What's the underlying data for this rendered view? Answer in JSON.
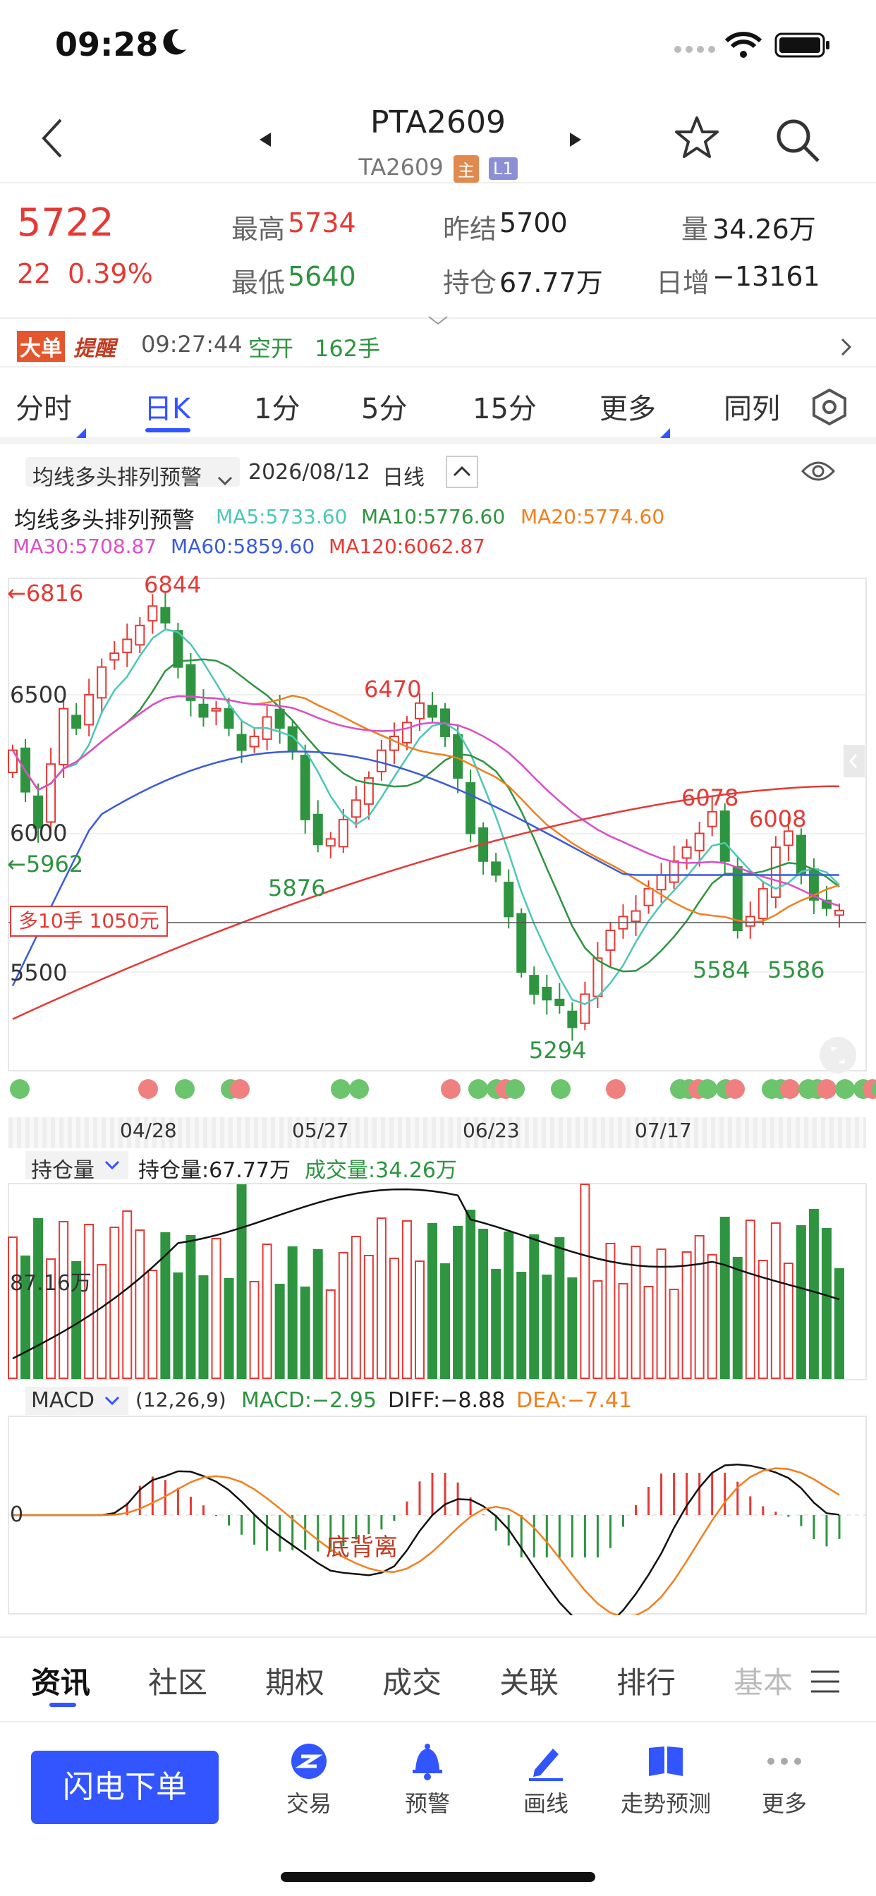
{
  "status": {
    "time": "09:28"
  },
  "nav": {
    "title": "PTA2609",
    "subtitle": "TA2609",
    "badge_main": "主",
    "badge_l1": "L1"
  },
  "quote": {
    "price": "5722",
    "change": "22",
    "change_pct": "0.39%",
    "high_label": "最高",
    "high": "5734",
    "low_label": "最低",
    "low": "5640",
    "prev_label": "昨结",
    "prev": "5700",
    "oi_label": "持仓",
    "oi": "67.77万",
    "vol_label": "量",
    "vol": "34.26万",
    "daily_label": "日增",
    "daily": "−13161"
  },
  "alert": {
    "tag1": "大单",
    "tag2": "提醒",
    "time": "09:27:44",
    "action": "空开",
    "qty": "162手"
  },
  "tabs": [
    "分时",
    "日K",
    "1分",
    "5分",
    "15分",
    "更多",
    "同列"
  ],
  "indicator": {
    "name": "均线多头排列预警",
    "date": "2026/08/12",
    "period": "日线"
  },
  "ma": {
    "title": "均线多头排列预警",
    "ma5": "MA5:5733.60",
    "ma10": "MA10:5776.60",
    "ma20": "MA20:5774.60",
    "ma30": "MA30:5708.87",
    "ma60": "MA60:5859.60",
    "ma120": "MA120:6062.87"
  },
  "colors": {
    "up": "#e53935",
    "down": "#2e9440",
    "ma5": "#4cc7b8",
    "ma10": "#2e9440",
    "ma20": "#f0801e",
    "ma30": "#d94fc8",
    "ma60": "#3b5bdb",
    "ma120": "#e53935",
    "accent": "#3355ff"
  },
  "main_chart": {
    "high_mark": "←6816",
    "low_mark": "←5962",
    "y_labels": [
      "6500",
      "6000",
      "5500"
    ],
    "peaks": [
      "6844",
      "6470",
      "5876",
      "6078",
      "6008",
      "5584",
      "5586",
      "5294"
    ],
    "order_tag": "多10手 1050元",
    "dates": [
      "04/28",
      "05/27",
      "06/23",
      "07/17"
    ]
  },
  "volume": {
    "selector": "持仓量",
    "oi_label": "持仓量:67.77万",
    "vol_label": "成交量:34.26万",
    "axis": "87.16万"
  },
  "macd": {
    "selector": "MACD",
    "params": "(12,26,9)",
    "macd": "MACD:−2.95",
    "diff": "DIFF:−8.88",
    "dea": "DEA:−7.41",
    "zero": "0",
    "note": "底背离"
  },
  "bottom_tabs": [
    "资讯",
    "社区",
    "期权",
    "成交",
    "关联",
    "排行",
    "基本"
  ],
  "toolbar": {
    "order_btn": "闪电下单",
    "items": [
      "交易",
      "预警",
      "画线",
      "走势预测",
      "更多"
    ]
  },
  "chart_data": {
    "type": "candlestick",
    "price_axis_labels": [
      6500,
      6000,
      5500
    ],
    "marked_extremes": {
      "high": 6844,
      "swing_high": 6470,
      "swing_low_1": 5876,
      "recent_high_1": 6078,
      "recent_high_2": 6008,
      "low": 5294,
      "recent_low_1": 5584,
      "recent_low_2": 5586
    },
    "x_tick_labels": [
      "04/28",
      "05/27",
      "06/23",
      "07/17"
    ],
    "close_series_approx": [
      6300,
      6150,
      6020,
      6250,
      6450,
      6380,
      6500,
      6600,
      6650,
      6700,
      6750,
      6820,
      6760,
      6600,
      6480,
      6420,
      6450,
      6380,
      6300,
      6350,
      6420,
      6380,
      6300,
      6050,
      5960,
      5980,
      6050,
      6120,
      6200,
      6300,
      6350,
      6400,
      6470,
      6420,
      6350,
      6200,
      6000,
      5900,
      5850,
      5700,
      5500,
      5420,
      5400,
      5380,
      5300,
      5420,
      5550,
      5650,
      5700,
      5720,
      5800,
      5850,
      5900,
      5950,
      6000,
      6078,
      5900,
      5650,
      5700,
      5800,
      5950,
      6008,
      5850,
      5760,
      5730,
      5722
    ]
  }
}
